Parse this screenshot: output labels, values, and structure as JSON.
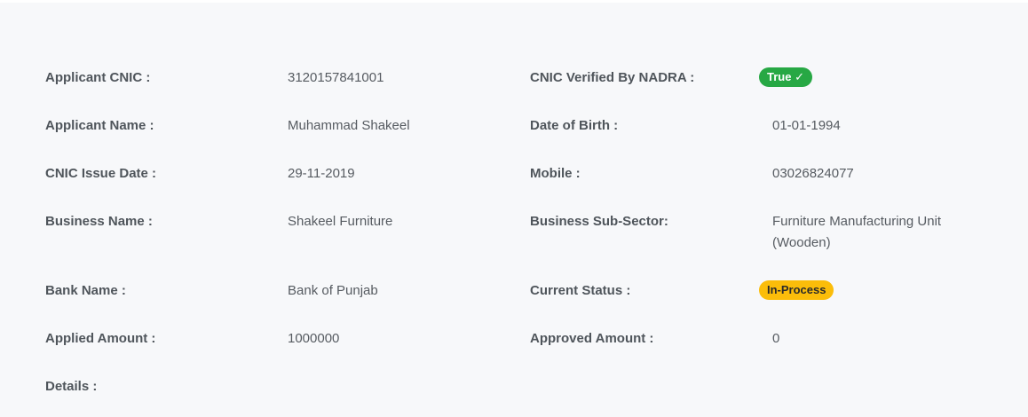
{
  "colors": {
    "panel_background": "#f7f8fa",
    "success": "#27a844",
    "warning": "#fbbd0a"
  },
  "left": {
    "applicant_cnic": {
      "label": "Applicant CNIC :",
      "value": "3120157841001"
    },
    "applicant_name": {
      "label": "Applicant Name :",
      "value": "Muhammad Shakeel"
    },
    "cnic_issue_date": {
      "label": "CNIC Issue Date :",
      "value": "29-11-2019"
    },
    "business_name": {
      "label": "Business Name :",
      "value": "Shakeel Furniture"
    },
    "bank_name": {
      "label": "Bank Name :",
      "value": "Bank of Punjab"
    },
    "applied_amount": {
      "label": "Applied Amount :",
      "value": "1000000"
    },
    "details": {
      "label": "Details :",
      "value": ""
    }
  },
  "right": {
    "cnic_verified": {
      "label": "CNIC Verified By NADRA :",
      "badge": "True ✓"
    },
    "date_of_birth": {
      "label": "Date of Birth :",
      "value": "01-01-1994"
    },
    "mobile": {
      "label": "Mobile :",
      "value": "03026824077"
    },
    "business_sub_sector": {
      "label": "Business Sub-Sector:",
      "value": "Furniture Manufacturing Unit (Wooden)"
    },
    "current_status": {
      "label": "Current Status :",
      "badge": "In-Process"
    },
    "approved_amount": {
      "label": "Approved Amount :",
      "value": "0"
    }
  }
}
